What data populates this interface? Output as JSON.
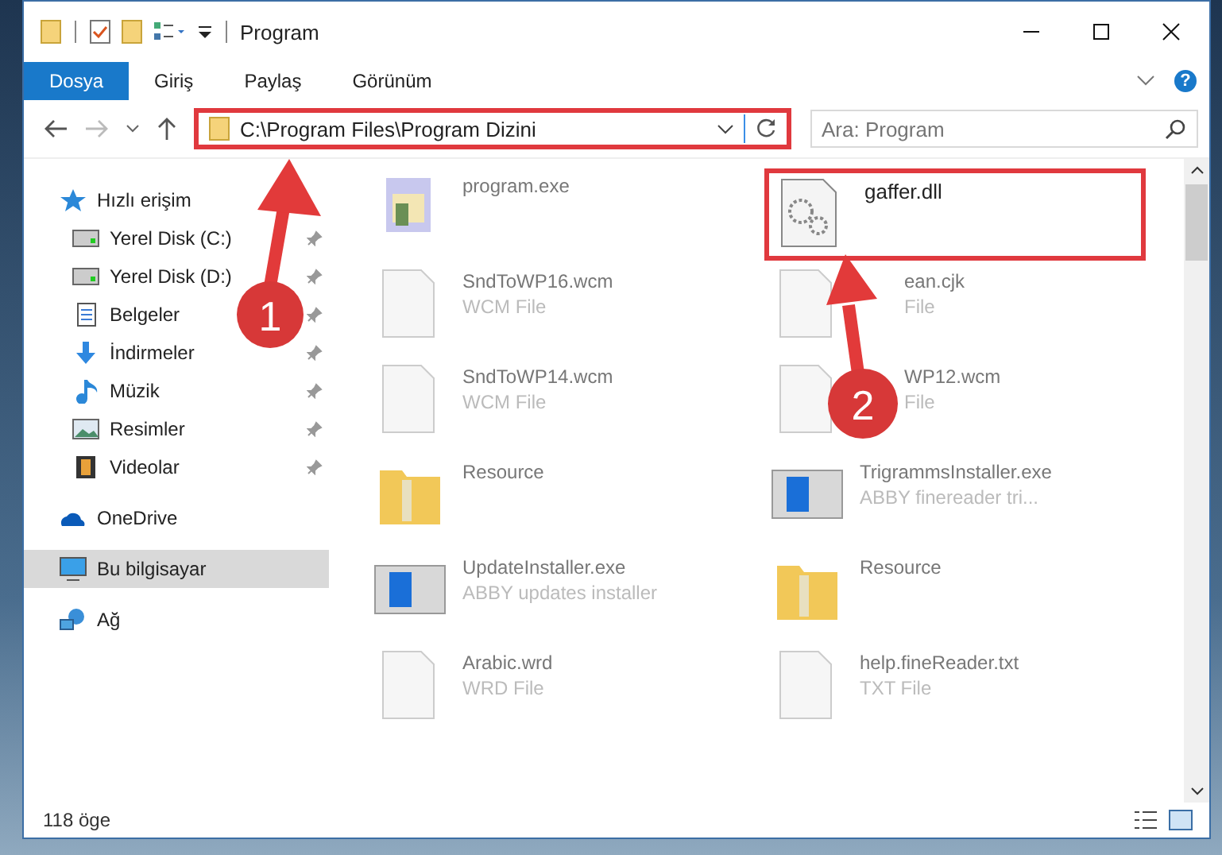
{
  "window": {
    "title": "Program"
  },
  "ribbon": {
    "tabs": [
      {
        "label": "Dosya",
        "selected": true
      },
      {
        "label": "Giriş",
        "selected": false
      },
      {
        "label": "Paylaş",
        "selected": false
      },
      {
        "label": "Görünüm",
        "selected": false
      }
    ],
    "help_glyph": "?"
  },
  "address": {
    "path": "C:\\Program Files\\Program Dizini",
    "highlighted": true
  },
  "search": {
    "placeholder": "Ara: Program"
  },
  "sidebar": {
    "items": [
      {
        "label": "Hızlı erişim",
        "kind": "star",
        "selected": false,
        "children": [
          {
            "label": "Yerel Disk (C:)",
            "kind": "drive",
            "pinned": true
          },
          {
            "label": "Yerel Disk (D:)",
            "kind": "drive",
            "pinned": true
          },
          {
            "label": "Belgeler",
            "kind": "docs",
            "pinned": true
          },
          {
            "label": "İndirmeler",
            "kind": "download",
            "pinned": true
          },
          {
            "label": "Müzik",
            "kind": "music",
            "pinned": true
          },
          {
            "label": "Resimler",
            "kind": "pictures",
            "pinned": true
          },
          {
            "label": "Videolar",
            "kind": "videos",
            "pinned": true
          }
        ]
      },
      {
        "label": "OneDrive",
        "kind": "cloud",
        "selected": false
      },
      {
        "label": "Bu bilgisayar",
        "kind": "pc",
        "selected": true
      },
      {
        "label": "Ağ",
        "kind": "network",
        "selected": false
      }
    ]
  },
  "files": [
    {
      "name": "program.exe",
      "kind": "exe",
      "highlighted": false
    },
    {
      "name": "gaffer.dll",
      "kind": "dll",
      "highlighted": true
    },
    {
      "name": "SndToWP16.wcm",
      "type": "WCM File",
      "kind": "file",
      "highlighted": false
    },
    {
      "name": "ean.cjk",
      "type": "File",
      "kind": "file",
      "highlighted": false,
      "covered": true
    },
    {
      "name": "SndToWP14.wcm",
      "type": "WCM File",
      "kind": "file",
      "highlighted": false
    },
    {
      "name": "WP12.wcm",
      "type": "File",
      "kind": "file",
      "highlighted": false,
      "covered": true
    },
    {
      "name": "Resource",
      "kind": "folder",
      "highlighted": false
    },
    {
      "name": "TrigrammsInstaller.exe",
      "type": "ABBY finereader tri...",
      "kind": "installer",
      "highlighted": false
    },
    {
      "name": "UpdateInstaller.exe",
      "type": "ABBY updates installer",
      "kind": "installer",
      "highlighted": false
    },
    {
      "name": "Resource",
      "kind": "folder",
      "highlighted": false
    },
    {
      "name": "Arabic.wrd",
      "type": "WRD File",
      "kind": "file",
      "highlighted": false
    },
    {
      "name": "help.fineReader.txt",
      "type": "TXT File",
      "kind": "file",
      "highlighted": false
    }
  ],
  "status_bar": {
    "count": "118 öge"
  },
  "annotations": [
    {
      "number": "1"
    },
    {
      "number": "2"
    }
  ]
}
